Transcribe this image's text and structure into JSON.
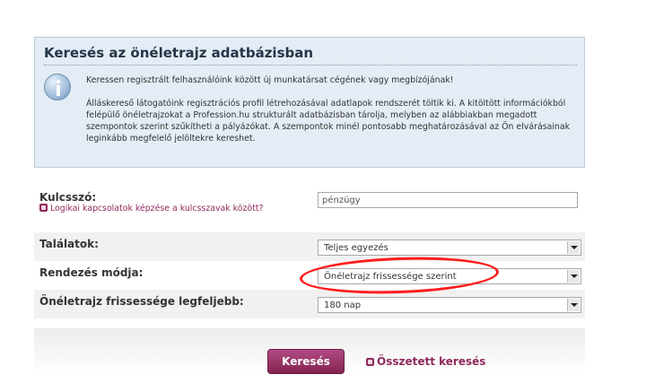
{
  "info": {
    "title": "Keresés az önéletrajz adatbázisban",
    "line1": "Keressen regisztrált felhasználóink között új munkatársat cégének vagy megbízójának!",
    "paragraph": "Álláskereső látogatóink regisztrációs profil létrehozásával adatlapok rendszerét töltik ki. A kitöltött információkból felépülő önéletrajzokat a Profession.hu strukturált adatbázisban tárolja, melyben az alábbiakban megadott szempontok szerint szűkítheti a pályázókat. A szempontok minél pontosabb meghatározásával az Ön elvárásainak leginkább megfelelő jelöltekre kereshet."
  },
  "form": {
    "keyword": {
      "label": "Kulcsszó:",
      "link": "Logikai kapcsolatok képzése a kulcsszavak között?",
      "value": "pénzügy"
    },
    "matches": {
      "label": "Találatok:",
      "value": "Teljes egyezés"
    },
    "sort": {
      "label": "Rendezés módja:",
      "value": "Önéletrajz frissessége szerint"
    },
    "freshness": {
      "label": "Önéletrajz frissessége legfeljebb:",
      "value": "180 nap"
    }
  },
  "actions": {
    "search_label": "Keresés",
    "advanced_label": "Összetett keresés"
  },
  "colors": {
    "accent": "#8e2a5d",
    "highlight": "#ff1c1c",
    "info_bg": "#e4edf5"
  }
}
